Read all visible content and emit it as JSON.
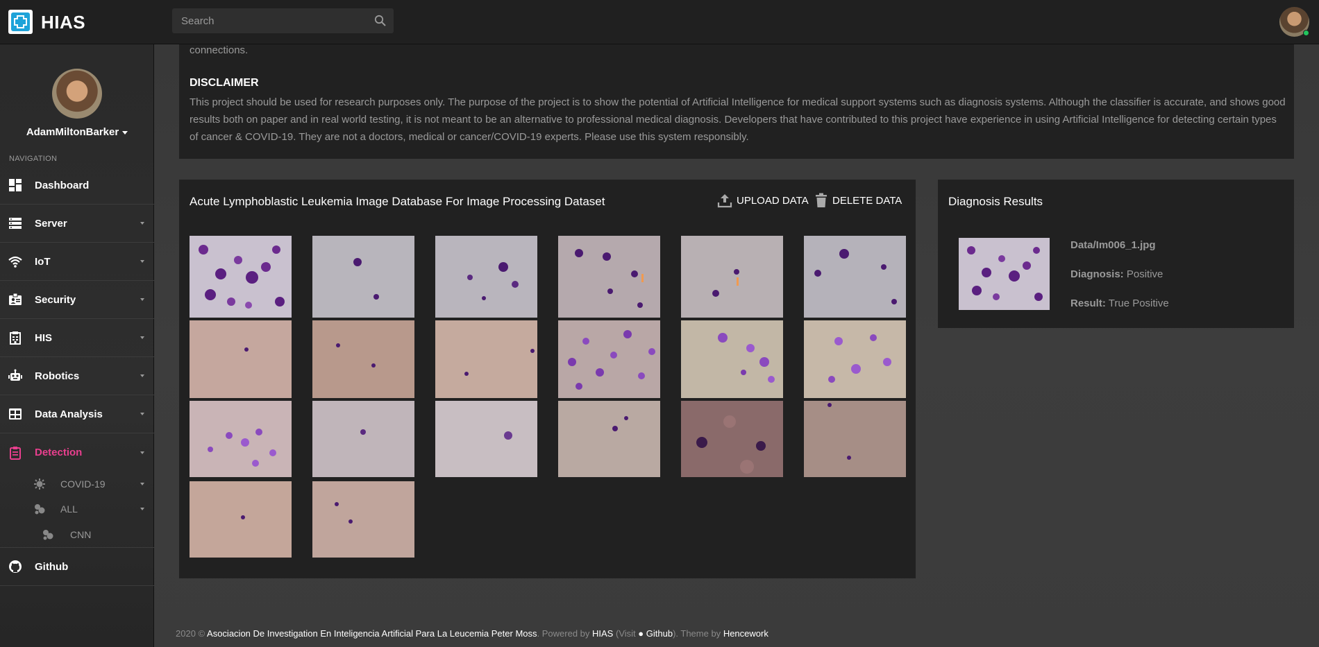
{
  "app": {
    "brand": "HIAS"
  },
  "search": {
    "placeholder": "Search"
  },
  "sidebar": {
    "user_name": "AdamMiltonBarker",
    "nav_label": "NAVIGATION",
    "items": [
      {
        "label": "Dashboard",
        "icon": "dashboard-icon"
      },
      {
        "label": "Server",
        "icon": "server-icon"
      },
      {
        "label": "IoT",
        "icon": "wifi-icon"
      },
      {
        "label": "Security",
        "icon": "id-badge-icon"
      },
      {
        "label": "HIS",
        "icon": "hospital-icon"
      },
      {
        "label": "Robotics",
        "icon": "robot-icon"
      },
      {
        "label": "Data Analysis",
        "icon": "table-icon"
      },
      {
        "label": "Detection",
        "icon": "clipboard-icon"
      },
      {
        "label": "Github",
        "icon": "github-icon"
      }
    ],
    "sub_items": [
      {
        "label": "COVID-19",
        "icon": "virus-icon"
      },
      {
        "label": "ALL",
        "icon": "cells-icon"
      },
      {
        "label": "CNN",
        "icon": "cells-icon"
      }
    ]
  },
  "intro": {
    "fragment": "connections.",
    "heading": "DISCLAIMER",
    "text": "This project should be used for research purposes only. The purpose of the project is to show the potential of Artificial Intelligence for medical support systems such as diagnosis systems. Although the classifier is accurate, and shows good results both on paper and in real world testing, it is not meant to be an alternative to professional medical diagnosis. Developers that have contributed to this project have experience in using Artificial Intelligence for detecting certain types of cancer & COVID-19. They are not a doctors, medical or cancer/COVID-19 experts. Please use this system responsibly."
  },
  "dataset": {
    "title": "Acute Lymphoblastic Leukemia Image Database For Image Processing Dataset",
    "upload_label": "UPLOAD DATA",
    "delete_label": "DELETE DATA"
  },
  "diagnosis": {
    "title": "Diagnosis Results",
    "file": "Data/Im006_1.jpg",
    "diagnosis_label": "Diagnosis:",
    "diagnosis_value": "Positive",
    "result_label": "Result:",
    "result_value": "True Positive"
  },
  "footer": {
    "year": "2020 ©",
    "org": "Asociacion De Investigation En Inteligencia Artificial Para La Leucemia Peter Moss",
    "powered": ". Powered by",
    "hias": "HIAS",
    "visit": "(Visit",
    "github": "Github",
    "theme": "). Theme by",
    "theme_author": "Hencework"
  },
  "colors": {
    "accent": "#e93f8e",
    "panel": "#212121",
    "topbar": "#202020"
  }
}
